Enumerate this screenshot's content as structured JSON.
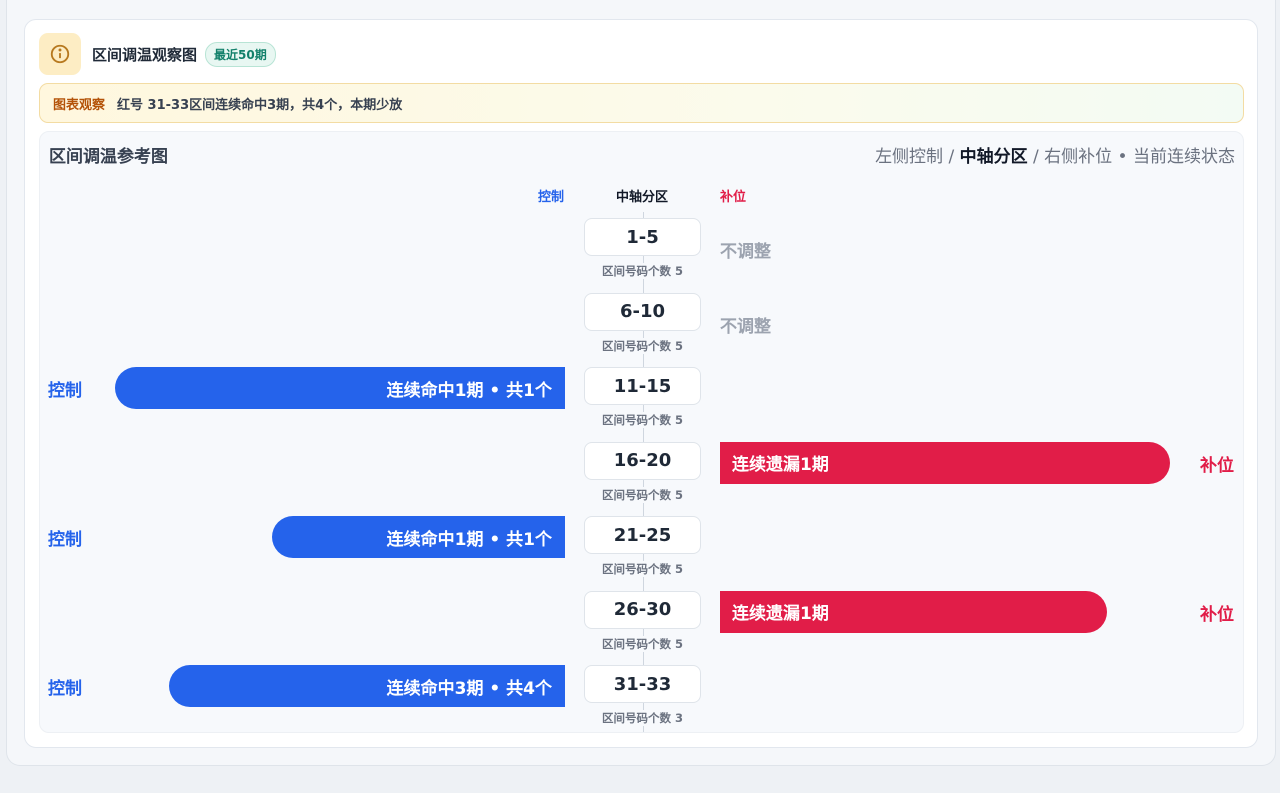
{
  "header": {
    "title": "区间调温观察图",
    "badge": "最近50期"
  },
  "notice": {
    "tag": "图表观察",
    "text": "红号 31-33区间连续命中3期，共4个，本期少放"
  },
  "panel": {
    "title": "区间调温参考图",
    "legend": {
      "left": "左侧控制",
      "center": "中轴分区",
      "right": "右侧补位",
      "sep": " / ",
      "dot": " • ",
      "state": "当前连续状态"
    },
    "columns": {
      "left": "控制",
      "center": "中轴分区",
      "right": "补位"
    }
  },
  "colors": {
    "control": "#2563eb",
    "fill": "#e11d48",
    "neutral": "#9ca3af"
  },
  "icons": {
    "header": "info-circle-icon"
  },
  "chart_data": {
    "type": "bar",
    "categories": [
      "1-5",
      "6-10",
      "11-15",
      "16-20",
      "21-25",
      "26-30",
      "31-33"
    ],
    "rows": [
      {
        "zone": "1-5",
        "count_label": "区间号码个数 5",
        "side": "none",
        "label": "不调整",
        "side_label": ""
      },
      {
        "zone": "6-10",
        "count_label": "区间号码个数 5",
        "side": "none",
        "label": "不调整",
        "side_label": ""
      },
      {
        "zone": "11-15",
        "count_label": "区间号码个数 5",
        "side": "left",
        "label": "连续命中1期 • 共1个",
        "side_label": "控制",
        "value": 1
      },
      {
        "zone": "16-20",
        "count_label": "区间号码个数 5",
        "side": "right",
        "label": "连续遗漏1期",
        "side_label": "补位",
        "value": 1
      },
      {
        "zone": "21-25",
        "count_label": "区间号码个数 5",
        "side": "left",
        "label": "连续命中1期 • 共1个",
        "side_label": "控制",
        "value": 1
      },
      {
        "zone": "26-30",
        "count_label": "区间号码个数 5",
        "side": "right",
        "label": "连续遗漏1期",
        "side_label": "补位",
        "value": 1
      },
      {
        "zone": "31-33",
        "count_label": "区间号码个数 3",
        "side": "left",
        "label": "连续命中3期 • 共4个",
        "side_label": "控制",
        "value": 3
      }
    ]
  }
}
